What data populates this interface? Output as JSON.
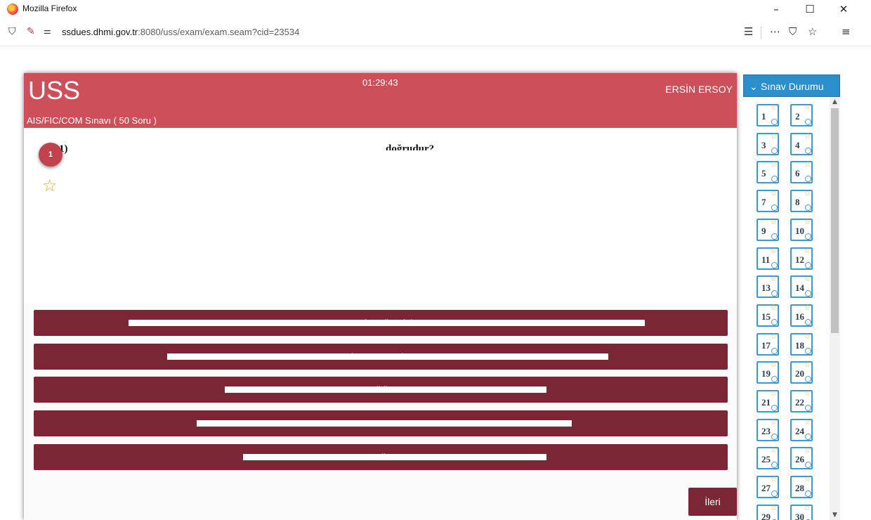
{
  "window": {
    "title": "Mozilla Firefox"
  },
  "browser": {
    "url_domain": "ssdues.dhmi.gov.tr",
    "url_path": ":8080/uss/exam/exam.seam?cid=23534"
  },
  "exam": {
    "title": "USS",
    "timer": "01:29:43",
    "user": "ERSİN ERSOY",
    "subtitle": "AIS/FIC/COM Sınavı ( 50 Soru )",
    "question_number": "1",
    "question_prefix": "1)",
    "question_visible_fragment": "doğrudur?",
    "options": [
      {
        "label": "...tarak verilecektir.."
      },
      {
        "label": "Bir NOTAM ...ktır."
      },
      {
        "label": "...lidir."
      },
      {
        "label": "...NOTAM..."
      },
      {
        "label": "...dir."
      }
    ],
    "next_label": "İleri"
  },
  "sidebar": {
    "header": "Sınav Durumu",
    "questions": [
      "1",
      "2",
      "3",
      "4",
      "5",
      "6",
      "7",
      "8",
      "9",
      "10",
      "11",
      "12",
      "13",
      "14",
      "15",
      "16",
      "17",
      "18",
      "19",
      "20",
      "21",
      "22",
      "23",
      "24",
      "25",
      "26",
      "27",
      "28",
      "29",
      "30"
    ]
  },
  "colors": {
    "header_red": "#cd4f5a",
    "option_maroon": "#7b2634",
    "sidebar_blue": "#2a8fca",
    "star_gold": "#e0b01a"
  }
}
